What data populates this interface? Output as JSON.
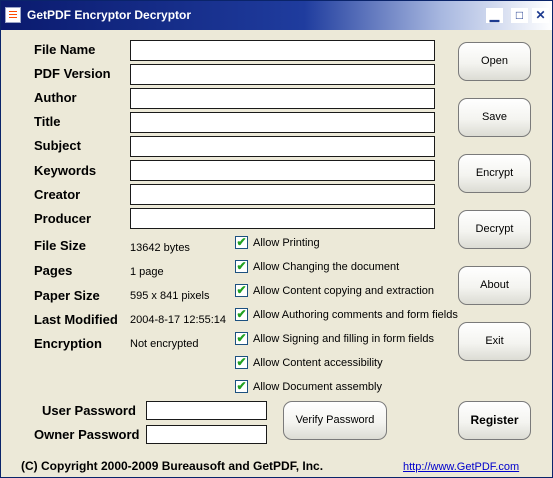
{
  "window": {
    "title": "GetPDF Encryptor Decryptor",
    "controls": {
      "minimize": "▁",
      "maximize": "□",
      "close": "✕"
    }
  },
  "fields": [
    {
      "label": "File Name",
      "value": ""
    },
    {
      "label": "PDF Version",
      "value": ""
    },
    {
      "label": "Author",
      "value": ""
    },
    {
      "label": "Title",
      "value": ""
    },
    {
      "label": "Subject",
      "value": ""
    },
    {
      "label": "Keywords",
      "value": ""
    },
    {
      "label": "Creator",
      "value": ""
    },
    {
      "label": "Producer",
      "value": ""
    }
  ],
  "info": [
    {
      "label": "File Size",
      "value": "13642 bytes"
    },
    {
      "label": "Pages",
      "value": "1 page"
    },
    {
      "label": "Paper Size",
      "value": "595 x 841 pixels"
    },
    {
      "label": "Last Modified",
      "value": "2004-8-17 12:55:14"
    },
    {
      "label": "Encryption",
      "value": "Not encrypted"
    }
  ],
  "permissions": [
    {
      "label": "Allow Printing",
      "checked": true
    },
    {
      "label": "Allow Changing the document",
      "checked": true
    },
    {
      "label": "Allow Content copying and extraction",
      "checked": true
    },
    {
      "label": "Allow Authoring comments and form fields",
      "checked": true
    },
    {
      "label": "Allow Signing and filling in form fields",
      "checked": true
    },
    {
      "label": "Allow Content accessibility",
      "checked": true
    },
    {
      "label": "Allow Document assembly",
      "checked": true
    }
  ],
  "check_mark": "✔",
  "buttons": {
    "open": "Open",
    "save": "Save",
    "encrypt": "Encrypt",
    "decrypt": "Decrypt",
    "about": "About",
    "exit": "Exit",
    "verify_password": "Verify Password",
    "register": "Register"
  },
  "passwords": {
    "user_label": "User Password",
    "user_value": "",
    "owner_label": "Owner Password",
    "owner_value": ""
  },
  "footer": {
    "copyright": "(C) Copyright 2000-2009 Bureausoft and GetPDF, Inc.",
    "link": "http://www.GetPDF.com"
  }
}
